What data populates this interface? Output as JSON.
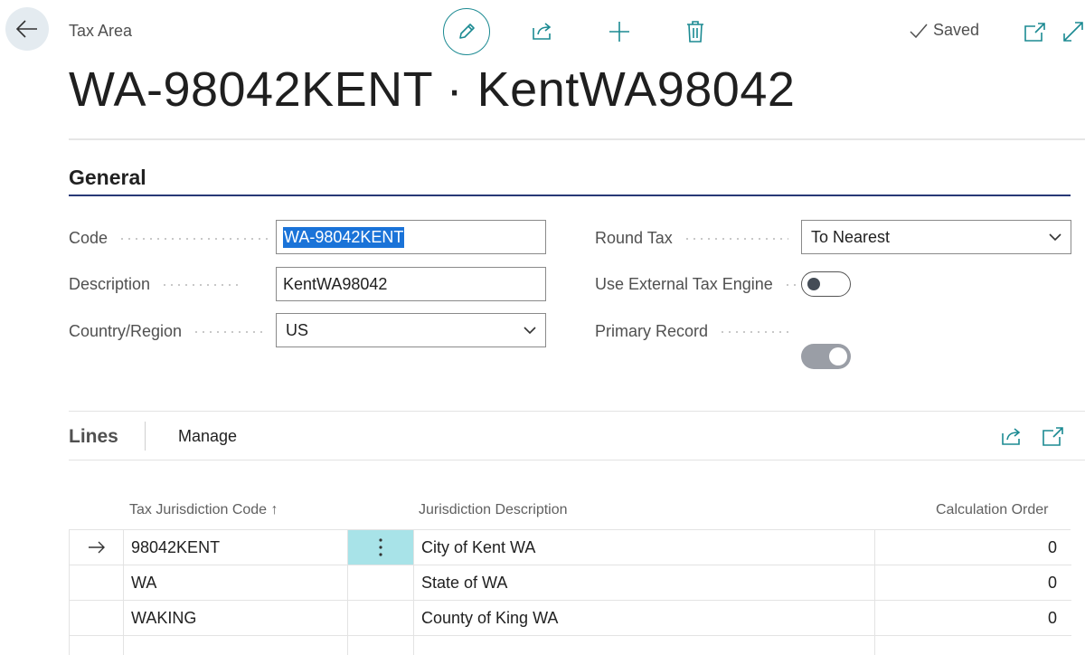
{
  "breadcrumb": "Tax Area",
  "page_title": "WA-98042KENT · KentWA98042",
  "status": "Saved",
  "general": {
    "title": "General",
    "code_label": "Code",
    "code_value": "WA-98042KENT",
    "description_label": "Description",
    "description_value": "KentWA98042",
    "country_label": "Country/Region",
    "country_value": "US",
    "round_tax_label": "Round Tax",
    "round_tax_value": "To Nearest",
    "external_engine_label": "Use External Tax Engine",
    "external_engine_on": false,
    "primary_record_label": "Primary Record",
    "primary_record_on": true
  },
  "lines": {
    "title": "Lines",
    "manage": "Manage",
    "columns": {
      "code": "Tax Jurisdiction Code ↑",
      "description": "Jurisdiction Description",
      "order": "Calculation Order"
    },
    "rows": [
      {
        "code": "98042KENT",
        "description": "City of Kent WA",
        "order": "0"
      },
      {
        "code": "WA",
        "description": "State of WA",
        "order": "0"
      },
      {
        "code": "WAKING",
        "description": "County of King WA",
        "order": "0"
      }
    ]
  },
  "colors": {
    "accent": "#1b8a92",
    "section_rule": "#273876",
    "selected_cell": "#a8e3e8",
    "selection_highlight": "#1a73d8"
  },
  "icons": [
    "back-arrow-icon",
    "pencil-icon",
    "share-icon",
    "plus-icon",
    "trash-icon",
    "checkmark-icon",
    "open-new-window-icon",
    "expand-icon",
    "chevron-down-icon",
    "row-arrow-icon",
    "more-vertical-icon"
  ]
}
